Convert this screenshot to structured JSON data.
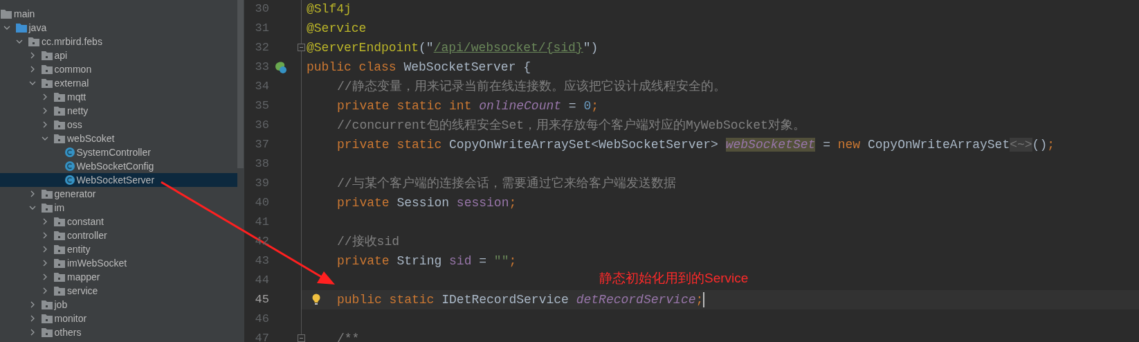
{
  "project_tree": {
    "items": [
      {
        "kind": "folder",
        "label": "main",
        "selected": false,
        "children": [
          {
            "kind": "source_root",
            "label": "java",
            "selected": false,
            "expanded": true,
            "children": [
              {
                "kind": "package",
                "label": "cc.mrbird.febs",
                "selected": false,
                "expanded": true,
                "children": [
                  {
                    "kind": "package",
                    "label": "api",
                    "selected": false,
                    "expanded": false
                  },
                  {
                    "kind": "package",
                    "label": "common",
                    "selected": false,
                    "expanded": false
                  },
                  {
                    "kind": "package",
                    "label": "external",
                    "selected": false,
                    "expanded": true,
                    "children": [
                      {
                        "kind": "package",
                        "label": "mqtt",
                        "selected": false,
                        "expanded": false
                      },
                      {
                        "kind": "package",
                        "label": "netty",
                        "selected": false,
                        "expanded": false
                      },
                      {
                        "kind": "package",
                        "label": "oss",
                        "selected": false,
                        "expanded": false
                      },
                      {
                        "kind": "package",
                        "label": "webScoket",
                        "selected": false,
                        "expanded": true,
                        "children": [
                          {
                            "kind": "class",
                            "label": "SystemController",
                            "selected": false
                          },
                          {
                            "kind": "class",
                            "label": "WebSocketConfig",
                            "selected": false
                          },
                          {
                            "kind": "class",
                            "label": "WebSocketServer",
                            "selected": true
                          }
                        ]
                      }
                    ]
                  },
                  {
                    "kind": "package",
                    "label": "generator",
                    "selected": false,
                    "expanded": false
                  },
                  {
                    "kind": "package",
                    "label": "im",
                    "selected": false,
                    "expanded": true,
                    "children": [
                      {
                        "kind": "package",
                        "label": "constant",
                        "selected": false,
                        "expanded": false
                      },
                      {
                        "kind": "package",
                        "label": "controller",
                        "selected": false,
                        "expanded": false
                      },
                      {
                        "kind": "package",
                        "label": "entity",
                        "selected": false,
                        "expanded": false
                      },
                      {
                        "kind": "package",
                        "label": "imWebSocket",
                        "selected": false,
                        "expanded": false
                      },
                      {
                        "kind": "package",
                        "label": "mapper",
                        "selected": false,
                        "expanded": false
                      },
                      {
                        "kind": "package",
                        "label": "service",
                        "selected": false,
                        "expanded": false
                      }
                    ]
                  },
                  {
                    "kind": "package",
                    "label": "job",
                    "selected": false,
                    "expanded": false
                  },
                  {
                    "kind": "package",
                    "label": "monitor",
                    "selected": false,
                    "expanded": false
                  },
                  {
                    "kind": "package",
                    "label": "others",
                    "selected": false,
                    "expanded": false
                  }
                ]
              }
            ]
          }
        ]
      }
    ]
  },
  "editor": {
    "lines": [
      {
        "number": "30",
        "indented": false,
        "tokens": [
          {
            "kind": "annotation",
            "text": "@Slf4j"
          }
        ]
      },
      {
        "number": "31",
        "indented": false,
        "tokens": [
          {
            "kind": "annotation",
            "text": "@Service"
          }
        ]
      },
      {
        "number": "32",
        "indented": false,
        "fold": true,
        "tokens": [
          {
            "kind": "annotation",
            "text": "@ServerEndpoint"
          },
          {
            "kind": "plain",
            "text": "(\""
          },
          {
            "kind": "string",
            "text": "/api/websocket/{sid}"
          },
          {
            "kind": "plain",
            "text": "\")"
          }
        ]
      },
      {
        "number": "33",
        "indented": false,
        "gutter_icon": {
          "kind": "bean"
        },
        "tokens": [
          {
            "kind": "keyword",
            "text": "public class "
          },
          {
            "kind": "plain",
            "text": "WebSocketServer {"
          }
        ]
      },
      {
        "number": "34",
        "indented": true,
        "tokens": [
          {
            "kind": "comment",
            "text": "//静态变量，用来记录当前在线连接数。应该把它设计成线程安全的。"
          }
        ]
      },
      {
        "number": "35",
        "indented": true,
        "tokens": [
          {
            "kind": "keyword",
            "text": "private static int "
          },
          {
            "kind": "static_field",
            "text": "onlineCount"
          },
          {
            "kind": "plain",
            "text": " = "
          },
          {
            "kind": "number",
            "text": "0"
          },
          {
            "kind": "keyword",
            "text": ";"
          }
        ]
      },
      {
        "number": "36",
        "indented": true,
        "tokens": [
          {
            "kind": "comment",
            "text": "//concurrent包的线程安全Set，用来存放每个客户端对应的MyWebSocket对象。"
          }
        ]
      },
      {
        "number": "37",
        "indented": true,
        "tokens": [
          {
            "kind": "keyword",
            "text": "private static "
          },
          {
            "kind": "plain",
            "text": "CopyOnWriteArraySet<WebSocketServer> "
          },
          {
            "kind": "static_field_highlight",
            "text": "webSocketSet"
          },
          {
            "kind": "plain",
            "text": " = "
          },
          {
            "kind": "keyword",
            "text": "new "
          },
          {
            "kind": "plain",
            "text": "CopyOnWriteArraySet"
          },
          {
            "kind": "hint",
            "text": "<~>"
          },
          {
            "kind": "plain",
            "text": "()"
          },
          {
            "kind": "keyword",
            "text": ";"
          }
        ]
      },
      {
        "number": "38"
      },
      {
        "number": "39",
        "indented": true,
        "tokens": [
          {
            "kind": "comment",
            "text": "//与某个客户端的连接会话，需要通过它来给客户端发送数据"
          }
        ]
      },
      {
        "number": "40",
        "indented": true,
        "tokens": [
          {
            "kind": "keyword",
            "text": "private "
          },
          {
            "kind": "plain",
            "text": "Session "
          },
          {
            "kind": "field",
            "text": "session"
          },
          {
            "kind": "keyword",
            "text": ";"
          }
        ]
      },
      {
        "number": "41"
      },
      {
        "number": "42",
        "indented": true,
        "tokens": [
          {
            "kind": "comment",
            "text": "//接收sid"
          }
        ]
      },
      {
        "number": "43",
        "indented": true,
        "tokens": [
          {
            "kind": "keyword",
            "text": "private "
          },
          {
            "kind": "plain",
            "text": "String "
          },
          {
            "kind": "field",
            "text": "sid"
          },
          {
            "kind": "plain",
            "text": " = "
          },
          {
            "kind": "string_plain",
            "text": "\"\""
          },
          {
            "kind": "keyword",
            "text": ";"
          }
        ]
      },
      {
        "number": "44"
      },
      {
        "number": "45",
        "indented": true,
        "current": true,
        "gutter_icon": {
          "kind": "bulb"
        },
        "tokens": [
          {
            "kind": "keyword",
            "text": "public static "
          },
          {
            "kind": "plain",
            "text": "IDetRecordService "
          },
          {
            "kind": "static_field",
            "text": "detRecordService"
          },
          {
            "kind": "keyword",
            "text": ";"
          }
        ]
      },
      {
        "number": "46"
      },
      {
        "number": "47",
        "indented": true,
        "fold": true,
        "tokens": [
          {
            "kind": "comment",
            "text": "/**"
          }
        ]
      }
    ]
  },
  "annotation": {
    "text": "静态初始化用到的Service"
  }
}
